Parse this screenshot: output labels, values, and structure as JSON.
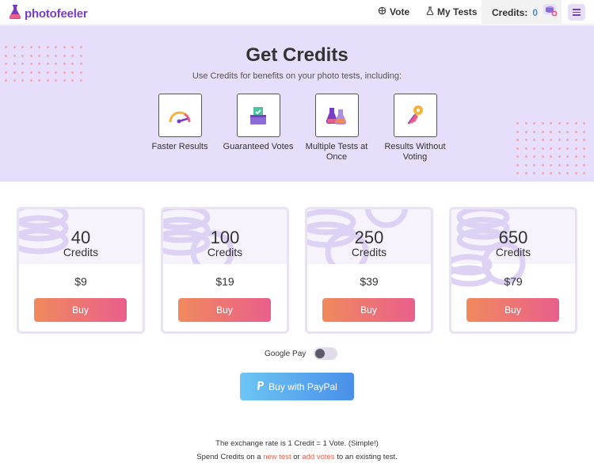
{
  "header": {
    "brand": "photofeeler",
    "nav_vote": "Vote",
    "nav_tests": "My Tests",
    "credits_label": "Credits:",
    "credits_count": "0"
  },
  "hero": {
    "title": "Get Credits",
    "subtitle": "Use Credits for benefits on your photo tests, including:",
    "benefits": [
      {
        "label": "Faster Results",
        "icon": "speedometer-icon"
      },
      {
        "label": "Guaranteed Votes",
        "icon": "ballot-box-icon"
      },
      {
        "label": "Multiple Tests at Once",
        "icon": "flasks-icon"
      },
      {
        "label": "Results Without Voting",
        "icon": "key-icon"
      }
    ]
  },
  "packages": [
    {
      "amount": "40",
      "unit": "Credits",
      "price": "$9",
      "buy": "Buy"
    },
    {
      "amount": "100",
      "unit": "Credits",
      "price": "$19",
      "buy": "Buy"
    },
    {
      "amount": "250",
      "unit": "Credits",
      "price": "$39",
      "buy": "Buy"
    },
    {
      "amount": "650",
      "unit": "Credits",
      "price": "$79",
      "buy": "Buy"
    }
  ],
  "google_pay": {
    "label": "Google Pay",
    "enabled": false
  },
  "paypal": {
    "label": "Buy with PayPal"
  },
  "footer": {
    "exchange": "The exchange rate is 1 Credit = 1 Vote. (Simple!)",
    "spend_prefix": "Spend Credits on a",
    "new_test": "new test",
    "or": "or",
    "add_votes": "add votes",
    "spend_suffix": "to an existing test."
  },
  "colors": {
    "brand": "#7a3cc4",
    "hero_bg": "#e6defa",
    "buy_gradient_start": "#f08a5d",
    "buy_gradient_end": "#e95f8c",
    "paypal_gradient_start": "#6dc6f5",
    "paypal_gradient_end": "#4a8fe8",
    "link": "#e8604c"
  }
}
